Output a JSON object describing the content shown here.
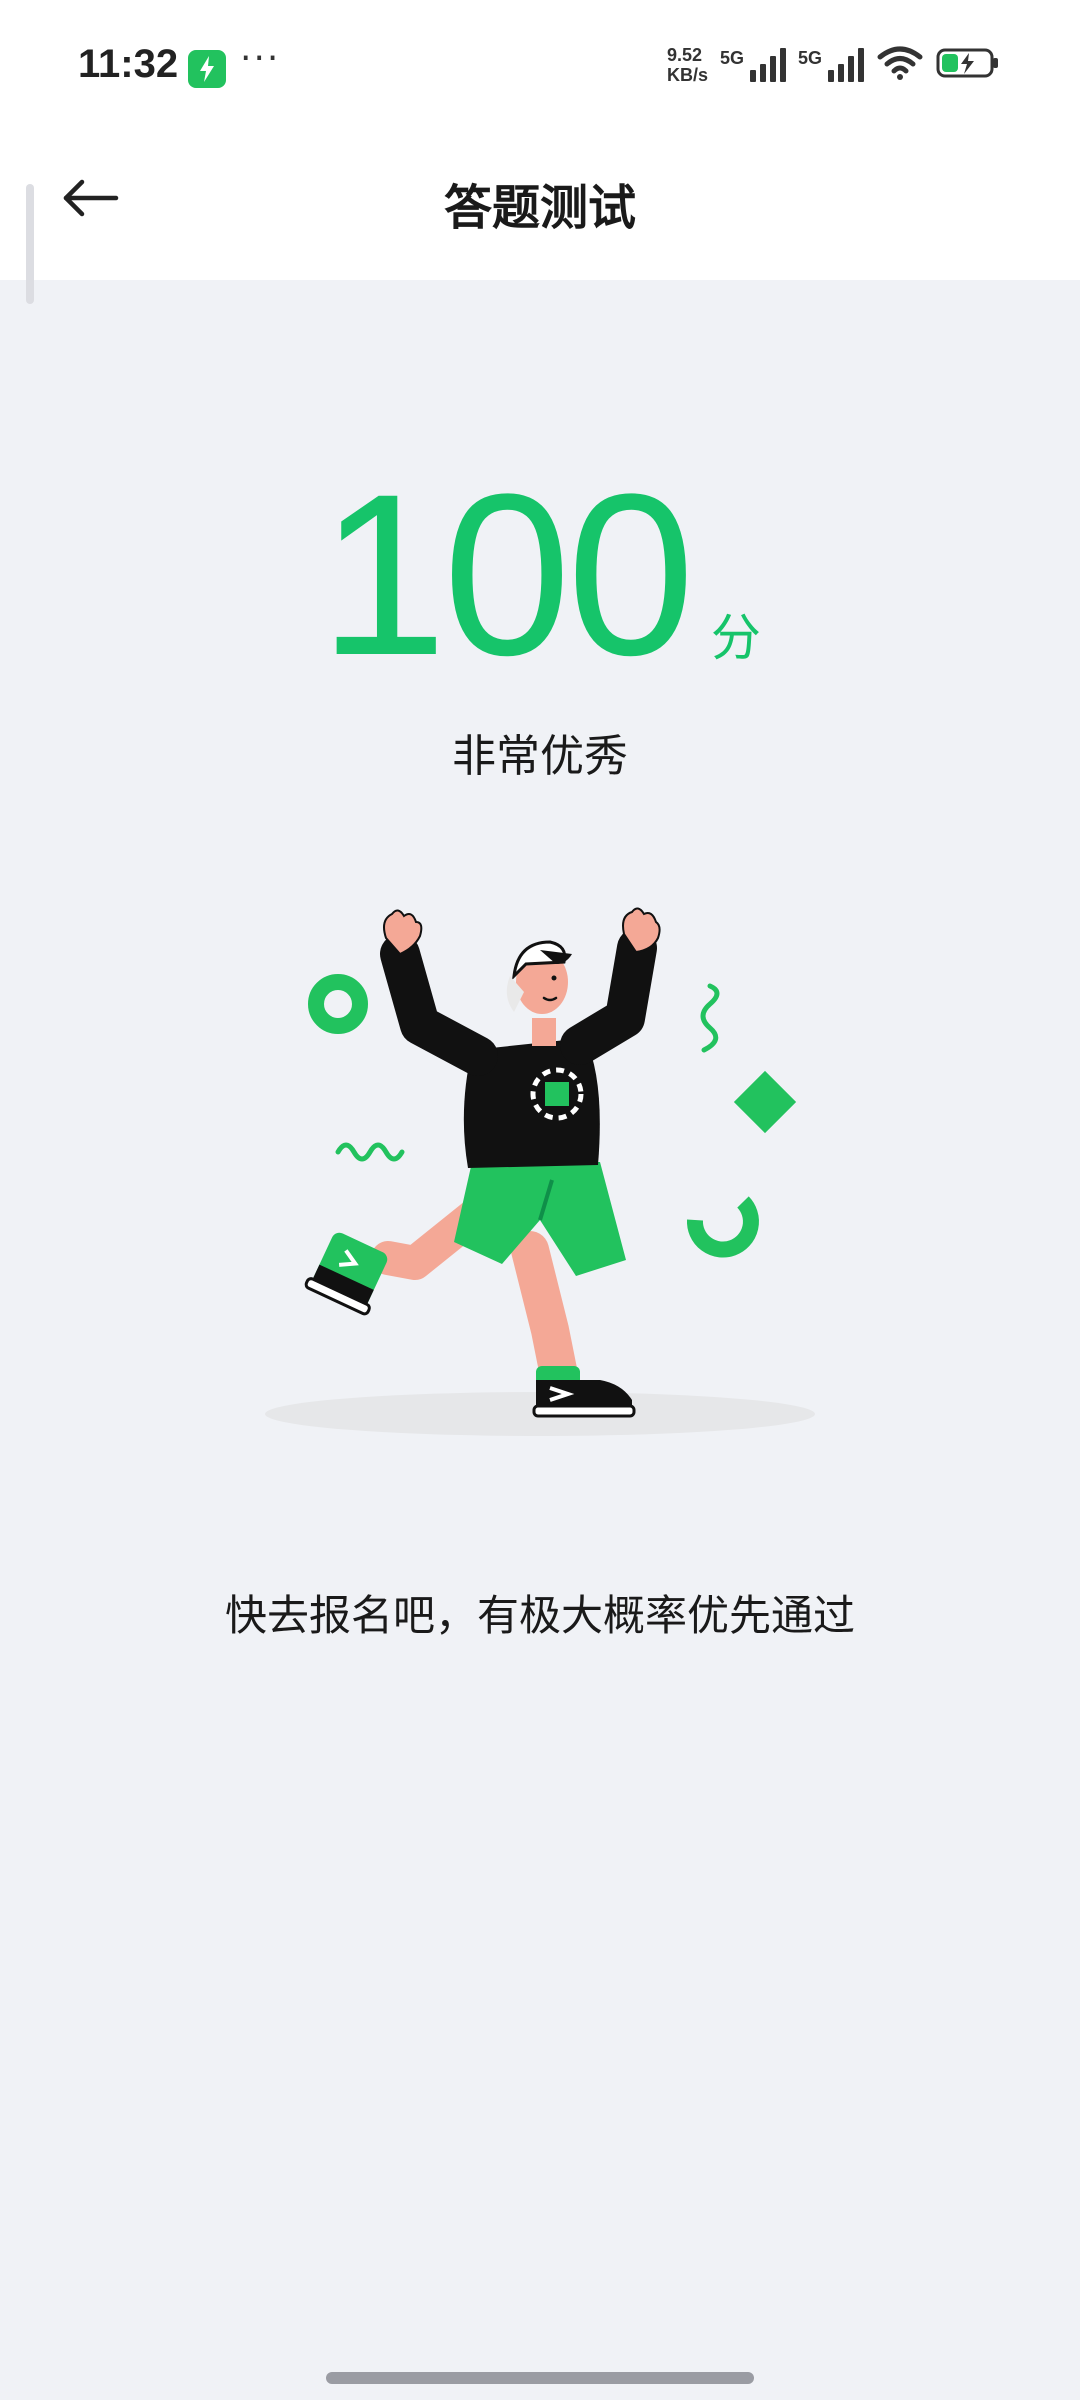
{
  "status_bar": {
    "time": "11:32",
    "net_speed_value": "9.52",
    "net_speed_unit": "KB/s",
    "signal1_label": "5G",
    "signal2_label": "5G",
    "app_icon": "lightning-app-icon",
    "more_icon": "more-dots-icon",
    "wifi_icon": "wifi-icon",
    "battery_icon": "battery-charging-icon"
  },
  "header": {
    "title": "答题测试",
    "back_icon": "arrow-left-icon"
  },
  "result": {
    "score": "100",
    "unit": "分",
    "rating": "非常优秀",
    "message": "快去报名吧，有极大概率优先通过"
  },
  "colors": {
    "accent": "#16c46a",
    "background": "#f0f2f6",
    "header_bg": "#ffffff"
  },
  "illustration": {
    "icon": "celebrating-runner-illustration"
  }
}
